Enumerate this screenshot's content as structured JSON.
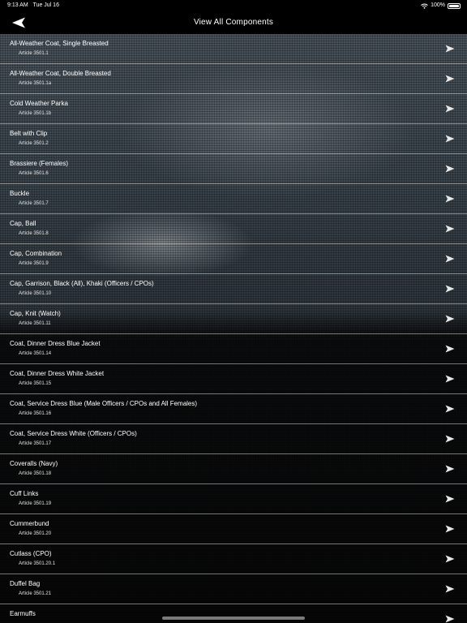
{
  "status": {
    "time": "9:13 AM",
    "date": "Tue Jul 16",
    "battery": "100%"
  },
  "nav": {
    "title": "View All Components",
    "back_icon": "arrow-left-icon"
  },
  "items": [
    {
      "title": "All-Weather Coat, Single Breasted",
      "article": "Article 3501.1"
    },
    {
      "title": "All-Weather Coat, Double Breasted",
      "article": "Article 3501.1a"
    },
    {
      "title": "Cold Weather Parka",
      "article": "Article 3501.1b"
    },
    {
      "title": "Belt with Clip",
      "article": "Article 3501.2"
    },
    {
      "title": "Brassiere (Females)",
      "article": "Article 3501.6"
    },
    {
      "title": "Buckle",
      "article": "Article 3501.7"
    },
    {
      "title": "Cap, Ball",
      "article": "Article 3501.8"
    },
    {
      "title": "Cap, Combination",
      "article": "Article 3501.9"
    },
    {
      "title": "Cap, Garrison, Black (All), Khaki (Officers / CPOs)",
      "article": "Article 3501.10"
    },
    {
      "title": "Cap, Knit (Watch)",
      "article": "Article 3501.11"
    },
    {
      "title": "Coat, Dinner Dress Blue Jacket",
      "article": "Article 3501.14"
    },
    {
      "title": "Coat, Dinner Dress White Jacket",
      "article": "Article 3501.15"
    },
    {
      "title": "Coat, Service Dress Blue (Male Officers / CPOs and All Females)",
      "article": "Article 3501.16"
    },
    {
      "title": "Coat, Service Dress White (Officers / CPOs)",
      "article": "Article 3501.17"
    },
    {
      "title": "Coveralls (Navy)",
      "article": "Article 3501.18"
    },
    {
      "title": "Cuff Links",
      "article": "Article 3501.19"
    },
    {
      "title": "Cummerbund",
      "article": "Article 3501.20"
    },
    {
      "title": "Cutlass (CPO)",
      "article": "Article 3501.20.1"
    },
    {
      "title": "Duffel Bag",
      "article": "Article 3501.21"
    },
    {
      "title": "Earmuffs",
      "article": ""
    }
  ],
  "row_icon": "arrow-right-icon"
}
